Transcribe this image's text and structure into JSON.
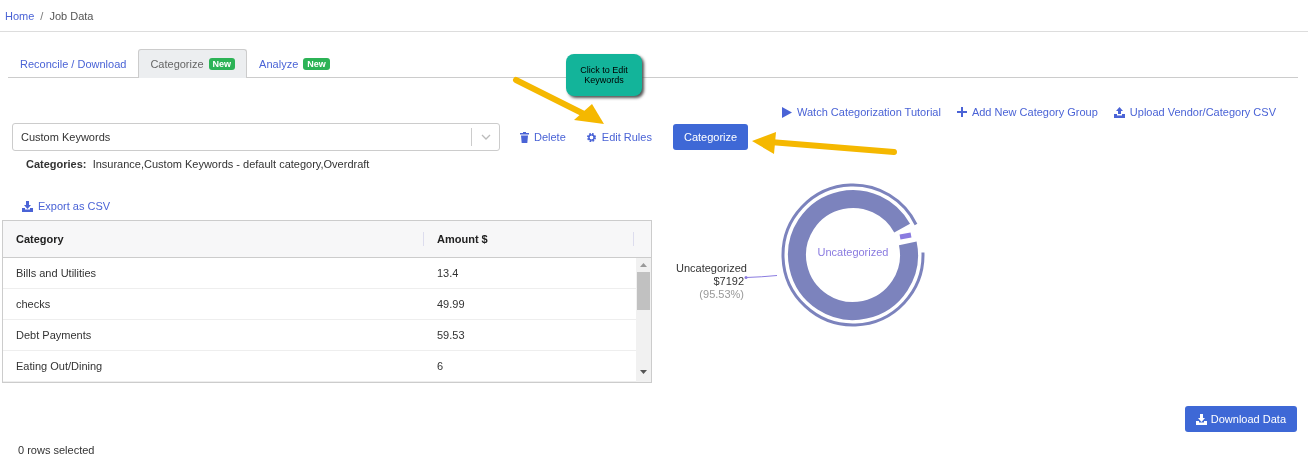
{
  "breadcrumb": [
    {
      "label": "Home",
      "link": true
    },
    {
      "label": "Job Data",
      "link": false
    }
  ],
  "breadcrumb_separator": "/",
  "tabs": [
    {
      "label": "Reconcile / Download",
      "selected": false
    },
    {
      "label": "Categorize",
      "badge": "New",
      "selected": true
    },
    {
      "label": "Analyze",
      "badge": "New",
      "selected": false
    }
  ],
  "top_links": [
    {
      "kind": "play",
      "label": "Watch Categorization Tutorial"
    },
    {
      "kind": "plus",
      "label": "Add New Category Group"
    },
    {
      "kind": "upload",
      "label": "Upload Vendor/Category CSV"
    }
  ],
  "category_group_select": {
    "value": "Custom Keywords"
  },
  "actions": [
    {
      "kind": "trash",
      "label": "Delete"
    },
    {
      "kind": "gear",
      "label": "Edit Rules"
    }
  ],
  "categorize_button": "Categorize",
  "categories": {
    "label": "Categories:",
    "value": "Insurance,Custom Keywords - default category,Overdraft"
  },
  "export_link": "Export as CSV",
  "table": {
    "columns": [
      "Category",
      "Amount $"
    ],
    "rows": [
      {
        "category": "Bills and Utilities",
        "amount": "13.4"
      },
      {
        "category": "checks",
        "amount": "49.99"
      },
      {
        "category": "Debt Payments",
        "amount": "59.53"
      },
      {
        "category": "Eating Out/Dining",
        "amount": "6"
      }
    ]
  },
  "donut": {
    "center_label": "Uncategorized",
    "slice_label": {
      "name": "Uncategorized",
      "value": "$7192",
      "percent": "(95.53%)"
    }
  },
  "callout": {
    "text": "Click to Edit Keywords"
  },
  "download_button": "Download Data",
  "status": "0 rows selected"
}
